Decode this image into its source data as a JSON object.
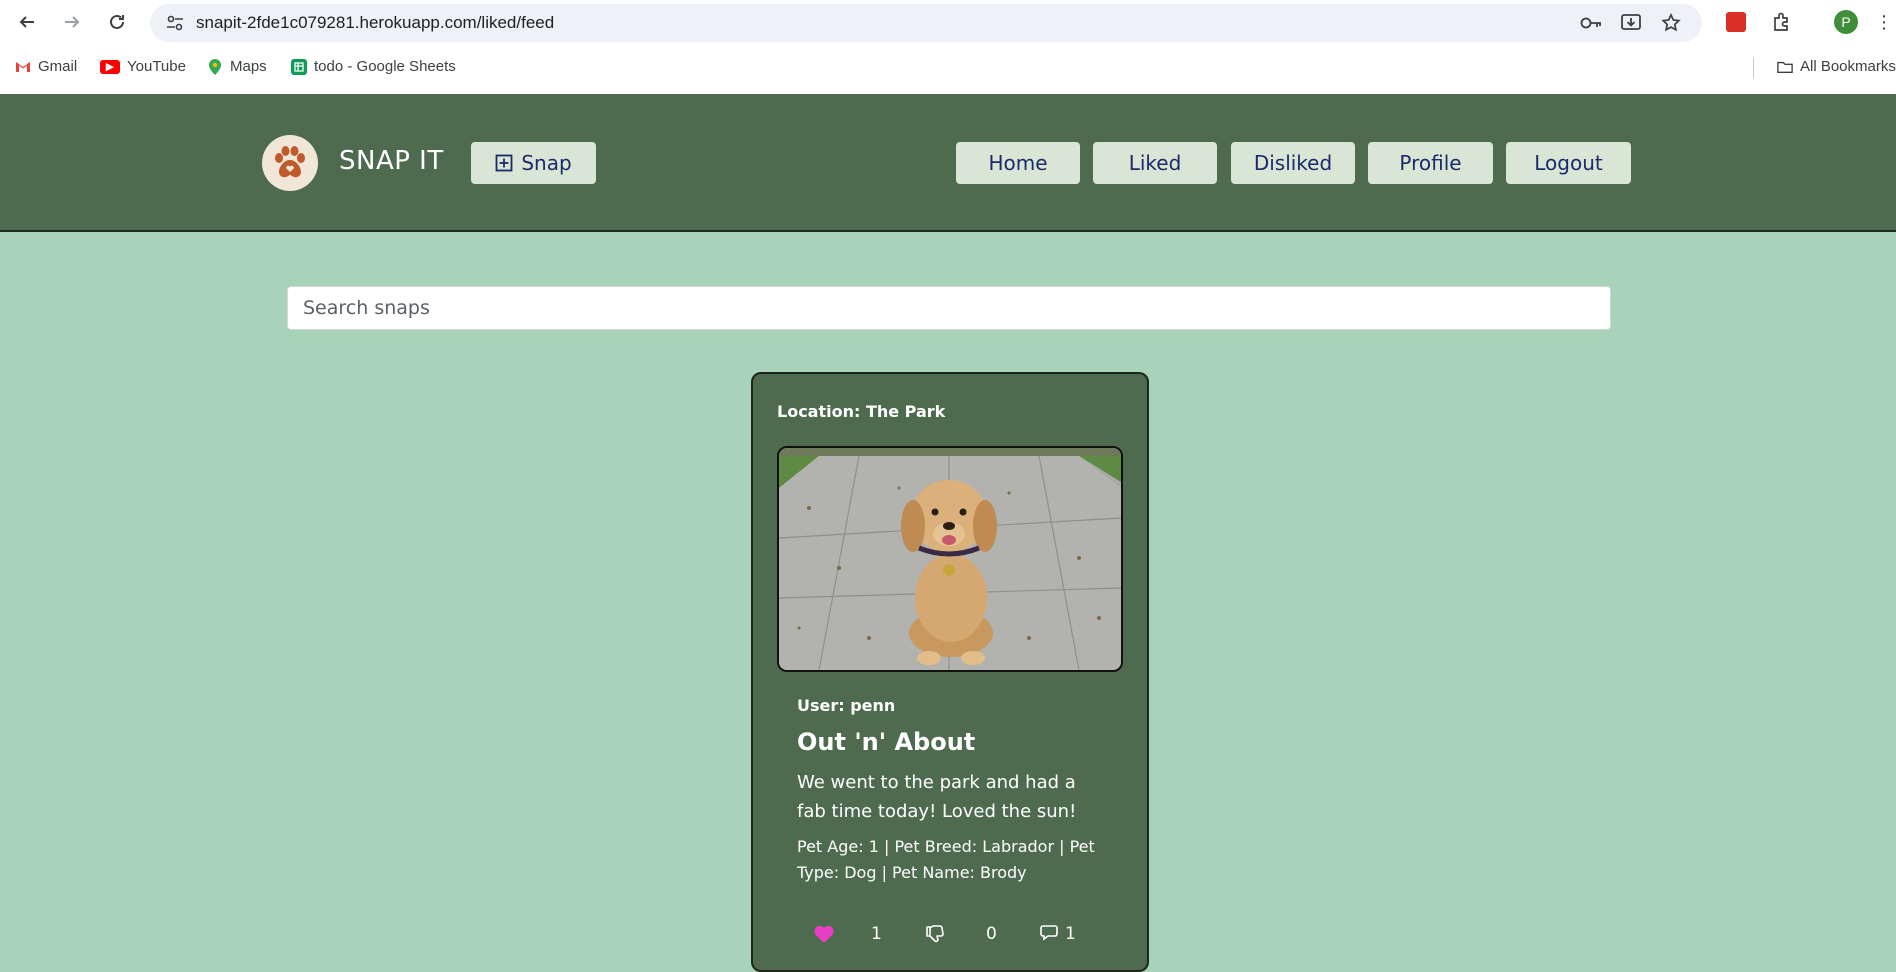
{
  "browser": {
    "url": "snapit-2fde1c079281.herokuapp.com/liked/feed",
    "profile_initial": "P",
    "bookmarks": [
      {
        "label": "Gmail"
      },
      {
        "label": "YouTube"
      },
      {
        "label": "Maps"
      },
      {
        "label": "todo - Google Sheets"
      }
    ],
    "all_bookmarks": "All Bookmarks"
  },
  "header": {
    "brand": "SNAP IT",
    "snap_label": "Snap",
    "nav": [
      {
        "label": "Home"
      },
      {
        "label": "Liked"
      },
      {
        "label": "Disliked"
      },
      {
        "label": "Profile"
      },
      {
        "label": "Logout"
      }
    ],
    "colors": {
      "bar": "#4e6b4f",
      "button": "#d9e6d5",
      "button_text": "#1c2a6b"
    }
  },
  "search": {
    "placeholder": "Search snaps",
    "value": ""
  },
  "feed": {
    "posts": [
      {
        "location": "Location: The Park",
        "user": "User: penn",
        "title": "Out 'n' About",
        "description": "We went to the park and had a fab time today! Loved the sun!",
        "meta": "Pet Age: 1 | Pet Breed: Labrador | Pet Type: Dog | Pet Name: Brody",
        "likes": "1",
        "dislikes": "0",
        "comments": "1",
        "liked": true,
        "like_color": "#e83fc4"
      }
    ]
  },
  "page_colors": {
    "background": "#a8d3b8"
  }
}
